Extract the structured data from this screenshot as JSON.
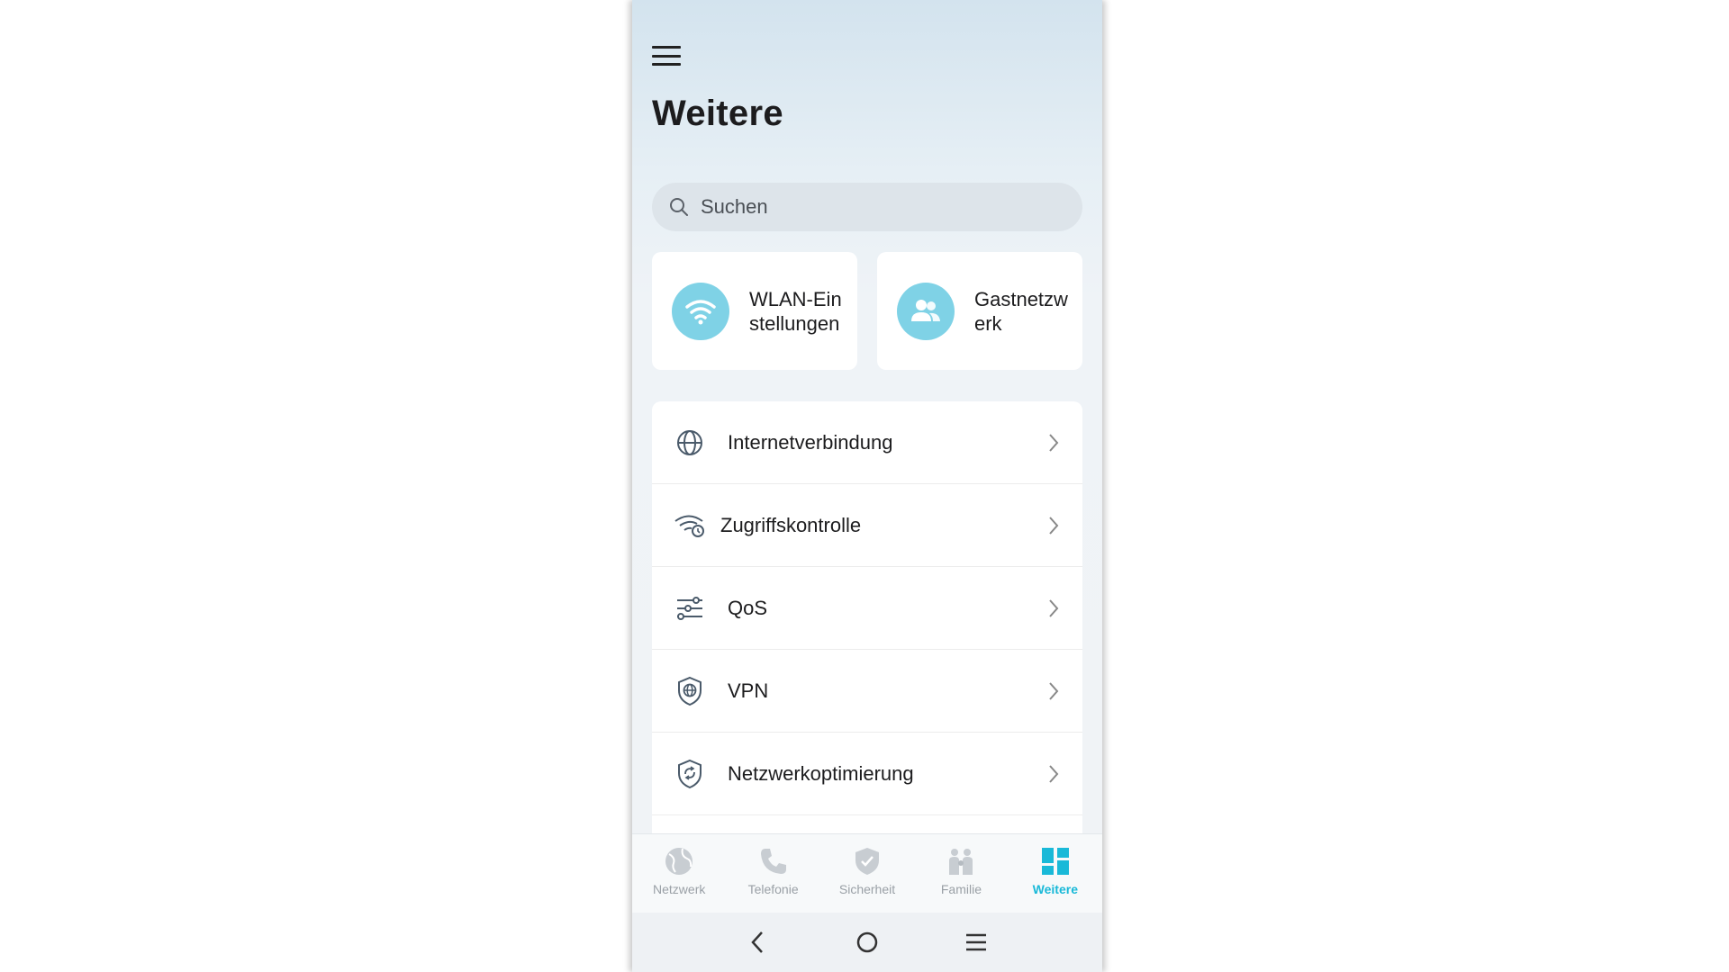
{
  "header": {
    "title": "Weitere"
  },
  "search": {
    "placeholder": "Suchen"
  },
  "quick_cards": [
    {
      "label": "WLAN-Einstellungen",
      "icon": "wifi-icon"
    },
    {
      "label": "Gastnetzwerk",
      "icon": "guests-icon"
    }
  ],
  "menu_items": [
    {
      "label": "Internetverbindung",
      "icon": "globe-icon"
    },
    {
      "label": "Zugriffskontrolle",
      "icon": "wifi-clock-icon"
    },
    {
      "label": "QoS",
      "icon": "sliders-icon"
    },
    {
      "label": "VPN",
      "icon": "shield-globe-icon"
    },
    {
      "label": "Netzwerkoptimierung",
      "icon": "shield-refresh-icon"
    }
  ],
  "tabs": [
    {
      "label": "Netzwerk",
      "icon": "globe-fill-icon",
      "active": false
    },
    {
      "label": "Telefonie",
      "icon": "phone-icon",
      "active": false
    },
    {
      "label": "Sicherheit",
      "icon": "shield-check-icon",
      "active": false
    },
    {
      "label": "Familie",
      "icon": "family-icon",
      "active": false
    },
    {
      "label": "Weitere",
      "icon": "dashboard-icon",
      "active": true
    }
  ],
  "colors": {
    "accent": "#19b9d8",
    "card_icon_bg": "#7fd2e6",
    "inactive_tab": "#9aa0a6"
  }
}
